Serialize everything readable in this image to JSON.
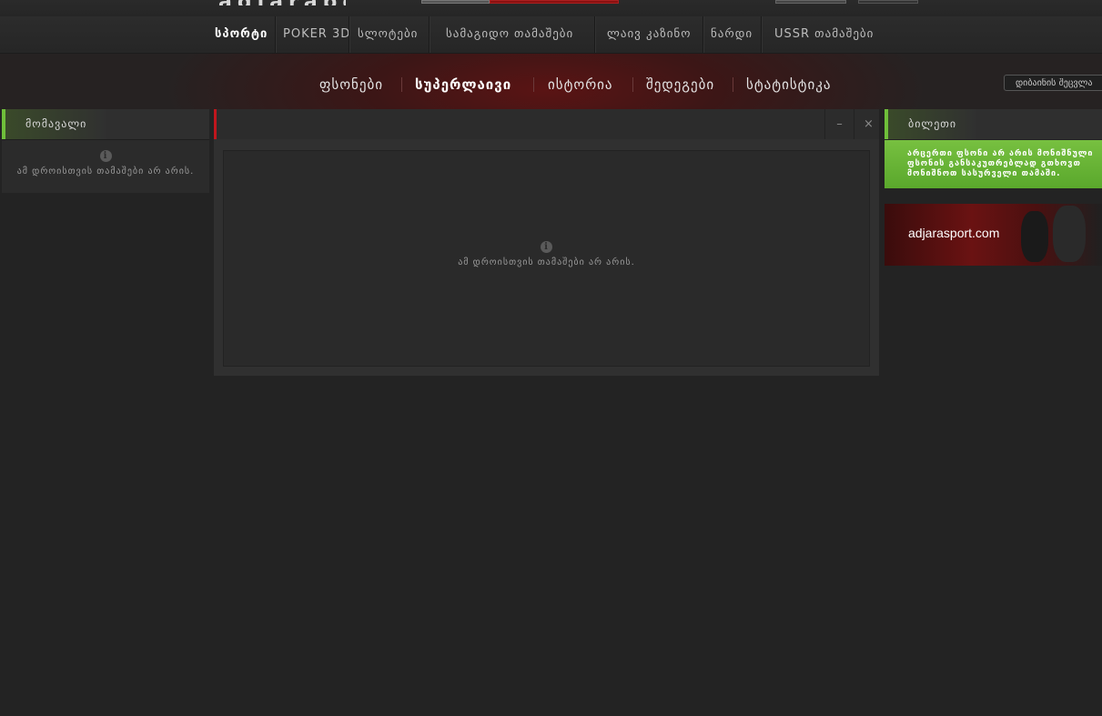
{
  "header": {
    "logo_text": "adjarabet"
  },
  "mainnav": {
    "items": [
      {
        "label": "სპორტი",
        "active": true
      },
      {
        "label": "POKER 3D"
      },
      {
        "label": "სლოტები"
      },
      {
        "label": "სამაგიდო თამაშები"
      },
      {
        "label": "ლაივ კაზინო"
      },
      {
        "label": "ნარდი"
      },
      {
        "label": "USSR თამაშები"
      }
    ]
  },
  "subnav": {
    "items": [
      {
        "label": "ფსონები"
      },
      {
        "label": "სუპერლაივი",
        "active": true
      },
      {
        "label": "ისტორია"
      },
      {
        "label": "შედეგები"
      },
      {
        "label": "სტატისტიკა"
      }
    ],
    "search_placeholder": "დიბაინის შეცვლა"
  },
  "left_panel": {
    "tab": "მომავალი",
    "empty_message": "ამ დროისთვის თამაშები არ არის."
  },
  "center_panel": {
    "minimize": "–",
    "close": "×",
    "empty_message": "ამ დროისთვის თამაშები არ არის."
  },
  "right_panel": {
    "tab": "ბილეთი",
    "ticket_message": "არცერთი ფსონი არ არის მონიშნული\nფსონის განსაკუთრებლად გთხოვთ\nმონიშნოთ სასურველი თამაში.",
    "ad_text": "adjarasport.com"
  },
  "colors": {
    "accent_green": "#6fbf3a",
    "accent_red": "#c0161d"
  }
}
